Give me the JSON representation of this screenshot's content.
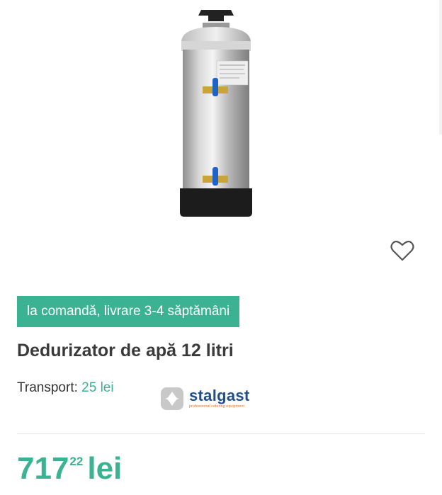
{
  "product": {
    "availability": "la comandă, livrare 3-4 săptămâni",
    "title": "Dedurizator de apă 12 litri",
    "shipping_label": "Transport:",
    "shipping_price": "25 lei",
    "brand": {
      "name": "stalgast",
      "tagline": "professional catering equipment",
      "icon": "stalgast-logo-icon"
    },
    "price": {
      "integer": "717",
      "decimal": "22",
      "currency": "lei"
    },
    "wishlist_icon": "heart-outline-icon"
  },
  "colors": {
    "accent": "#3bb291",
    "title": "#3a3a3a",
    "brand_blue": "#1f4f8c",
    "brand_orange": "#e0762a"
  }
}
